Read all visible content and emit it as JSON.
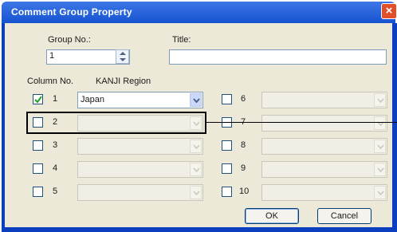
{
  "window": {
    "title": "Comment Group Property",
    "close_glyph": "×"
  },
  "group_no": {
    "label": "Group No.:",
    "value": "1"
  },
  "title_field": {
    "label": "Title:",
    "value": ""
  },
  "headers": {
    "column_no": "Column No.",
    "kanji_region": "KANJI Region"
  },
  "columns": [
    {
      "no": "1",
      "checked": true,
      "region": "Japan",
      "enabled": true
    },
    {
      "no": "2",
      "checked": false,
      "region": "",
      "enabled": false
    },
    {
      "no": "3",
      "checked": false,
      "region": "",
      "enabled": false
    },
    {
      "no": "4",
      "checked": false,
      "region": "",
      "enabled": false
    },
    {
      "no": "5",
      "checked": false,
      "region": "",
      "enabled": false
    },
    {
      "no": "6",
      "checked": false,
      "region": "",
      "enabled": false
    },
    {
      "no": "7",
      "checked": false,
      "region": "",
      "enabled": false
    },
    {
      "no": "8",
      "checked": false,
      "region": "",
      "enabled": false
    },
    {
      "no": "9",
      "checked": false,
      "region": "",
      "enabled": false
    },
    {
      "no": "10",
      "checked": false,
      "region": "",
      "enabled": false
    }
  ],
  "buttons": {
    "ok": "OK",
    "cancel": "Cancel"
  },
  "colors": {
    "titlebar": "#1553d0",
    "face": "#ece9d8",
    "check": "#21a121",
    "highlight": "#000000"
  }
}
